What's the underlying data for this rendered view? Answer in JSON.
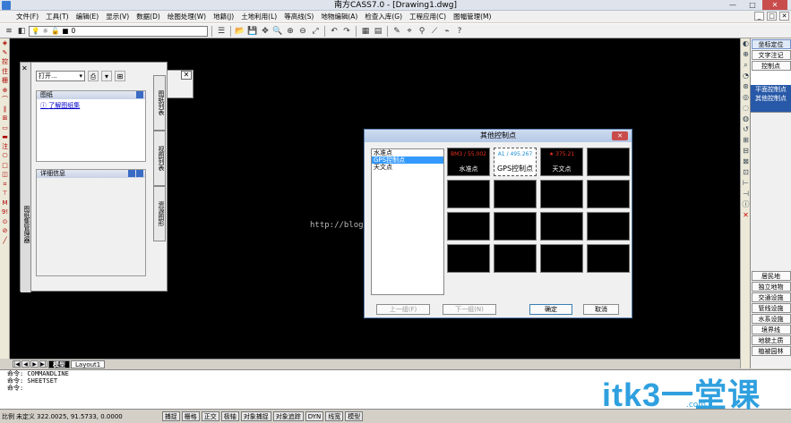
{
  "window": {
    "title": "南方CASS7.0 - [Drawing1.dwg]",
    "minimize": "—",
    "maximize": "□",
    "close": "✕"
  },
  "menu": [
    "文件(F)",
    "工具(T)",
    "编辑(E)",
    "显示(V)",
    "数据(D)",
    "绘图处理(W)",
    "地籍(J)",
    "土地利用(L)",
    "等高线(S)",
    "地物编辑(A)",
    "检查入库(G)",
    "工程应用(C)",
    "图幅管理(M)"
  ],
  "mdi": [
    "_",
    "□",
    "✕"
  ],
  "toolbar": {
    "layer_value": "0"
  },
  "left_tools": [
    "◈",
    "✎",
    "控",
    "住",
    "栅",
    "⊕",
    "⌒",
    "∥",
    "⊞",
    "▭",
    "▬",
    "注",
    "⎔",
    "□",
    "◫",
    "⌗",
    "⊤",
    "M",
    "9!",
    "⊙",
    "⊘",
    "╱"
  ],
  "right_tools": [
    "◐",
    "⊕",
    "⌕",
    "◔",
    "⊛",
    "◎",
    "◌",
    "◍",
    "↺",
    "⊞",
    "⊟",
    "⊠",
    "⊡",
    "⊢",
    "⊣",
    "ⓘ",
    "✕"
  ],
  "right_panel": {
    "top_buttons": [
      "坐标定位",
      "文字注记",
      "控制点"
    ],
    "blue_items": [
      "平面控制点",
      "其他控制点"
    ],
    "bottom_buttons": [
      "居民地",
      "独立地物",
      "交通设施",
      "管线设施",
      "水系设施",
      "境界线",
      "地貌土质",
      "植被园林"
    ]
  },
  "drawing_panel": {
    "open_label": "打开...",
    "section1_title": "图纸",
    "section1_link": "了解图纸集",
    "section2_title": "详细信息",
    "strip_text": "图纸集管理器",
    "tabs": [
      "图纸列表",
      "视图列表",
      "资源图形"
    ]
  },
  "dialog": {
    "title": "其他控制点",
    "list": [
      {
        "label": "水准点",
        "selected": false
      },
      {
        "label": "GPS控制点",
        "selected": true
      },
      {
        "label": "天文点",
        "selected": false
      }
    ],
    "cells": [
      {
        "top": "BM3 / 55.002",
        "label": "水准点",
        "selected": false
      },
      {
        "top": "A1 / 495.267",
        "label": "GPS控制点",
        "selected": true
      },
      {
        "top": "★ 375.21",
        "label": "天文点",
        "selected": false
      },
      {
        "top": "",
        "label": "",
        "selected": false
      },
      {
        "top": "",
        "label": "",
        "selected": false
      },
      {
        "top": "",
        "label": "",
        "selected": false
      },
      {
        "top": "",
        "label": "",
        "selected": false
      },
      {
        "top": "",
        "label": "",
        "selected": false
      },
      {
        "top": "",
        "label": "",
        "selected": false
      },
      {
        "top": "",
        "label": "",
        "selected": false
      },
      {
        "top": "",
        "label": "",
        "selected": false
      },
      {
        "top": "",
        "label": "",
        "selected": false
      },
      {
        "top": "",
        "label": "",
        "selected": false
      },
      {
        "top": "",
        "label": "",
        "selected": false
      },
      {
        "top": "",
        "label": "",
        "selected": false
      },
      {
        "top": "",
        "label": "",
        "selected": false
      }
    ],
    "prev_label": "上一组(F)",
    "next_label": "下一组(N)",
    "ok_label": "确定",
    "cancel_label": "取消"
  },
  "watermark": "http://blog.csdn.net/u012839390",
  "layout_tabs": [
    "模型",
    "Layout1"
  ],
  "command_lines": [
    "命令: COMMANDLINE",
    "命令: SHEETSET",
    "",
    "命令:"
  ],
  "status": {
    "scale": "比例",
    "undefined": "未定义",
    "coords": "322.0025, 91.5733, 0.0000",
    "buttons": [
      "捕捉",
      "栅格",
      "正交",
      "极轴",
      "对象捕捉",
      "对象追踪",
      "DYN",
      "线宽",
      "模型"
    ]
  },
  "logo": {
    "text": "itk3",
    "dash": "一",
    "cn": "堂课",
    "sub": ".com"
  }
}
